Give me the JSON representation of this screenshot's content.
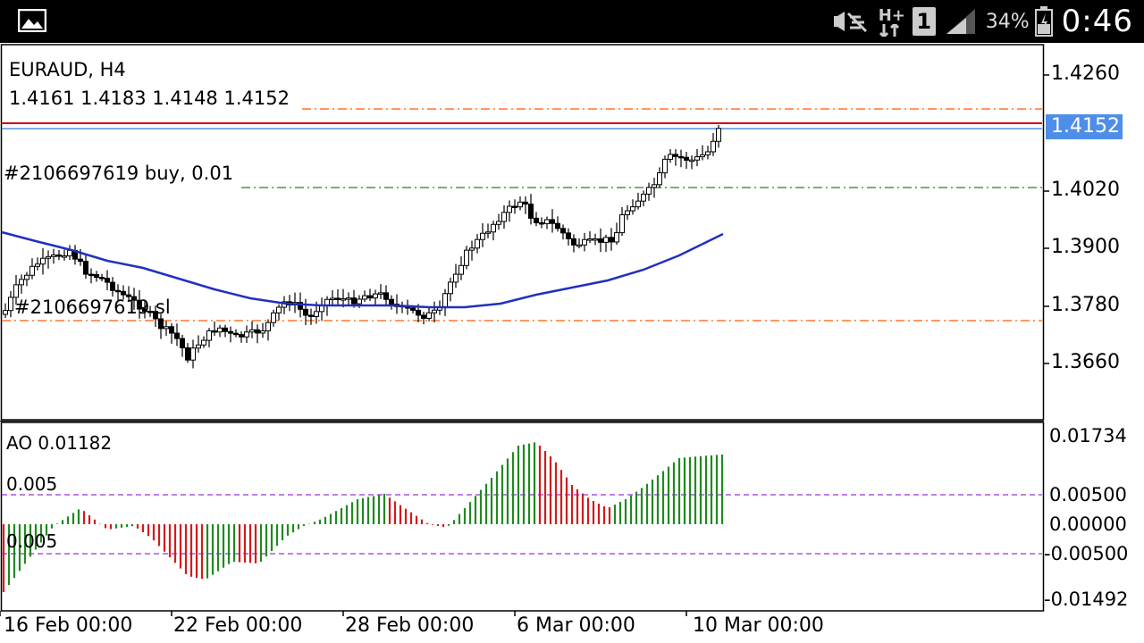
{
  "status_bar": {
    "battery_percent": "34%",
    "time": "0:46",
    "network_type": "H+",
    "sim_slot": "1",
    "icons": [
      "gallery-icon",
      "mute-icon",
      "hplus-network-icon",
      "sim-icon",
      "signal-icon",
      "battery-icon"
    ]
  },
  "chart": {
    "symbol": "EURAUD, H4",
    "ohlc": "1.4161 1.4183 1.4148 1.4152",
    "current_price": "1.4152",
    "price_ticks": [
      "1.4260",
      "1.4020",
      "1.3900",
      "1.3780",
      "1.3660"
    ],
    "time_ticks": [
      "16 Feb 00:00",
      "22 Feb 00:00",
      "28 Feb 00:00",
      "6 Mar 00:00",
      "10 Mar 00:00"
    ],
    "orders": {
      "buy_label": "#2106697619 buy, 0.01",
      "sl_label": "#2106697619 sl"
    }
  },
  "indicator": {
    "label": "AO 0.01182",
    "level_up_label": "0.005",
    "level_down_label": "0.005",
    "ticks": [
      "0.01734",
      "0.00500",
      "0.00000",
      "-0.00500",
      "-0.01492"
    ]
  },
  "colors": {
    "bid_line": "#d40000",
    "ask_line": "#5090e0",
    "tp_line": "#ff5a00",
    "entry_line": "#2e7d1e",
    "ma_line": "#2030c0",
    "ao_up": "#1f8a1f",
    "ao_down": "#d41a1a",
    "level_line": "#9b30e0",
    "price_badge": "#4f8ee8"
  }
}
